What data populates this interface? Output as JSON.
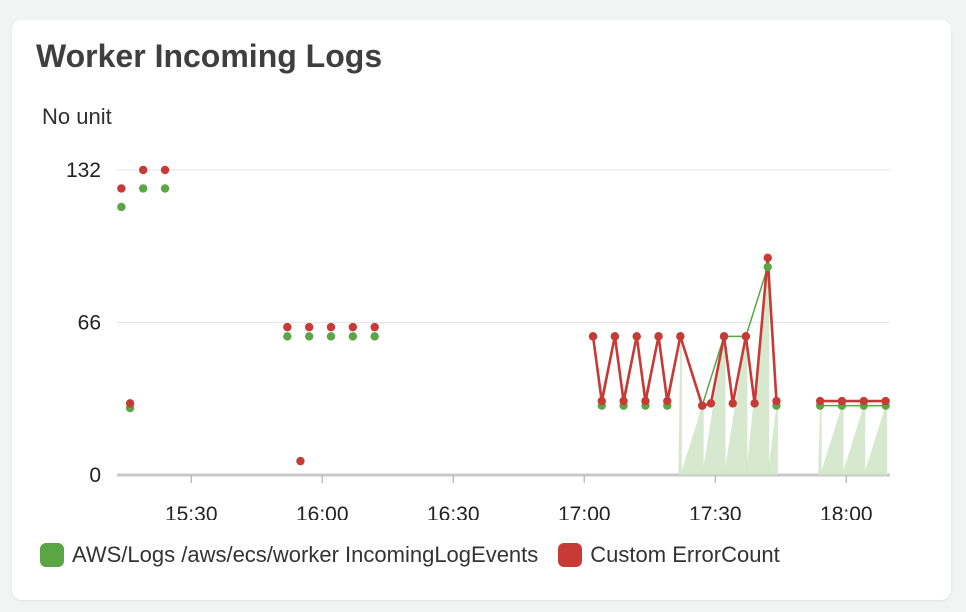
{
  "widget": {
    "title": "Worker Incoming Logs"
  },
  "chart_data": {
    "type": "line",
    "title": "Worker Incoming Logs",
    "ylabel": "No unit",
    "xlabel": "",
    "ylim": [
      0,
      132
    ],
    "yticks": [
      0,
      66,
      132
    ],
    "xlim": [
      "15:13",
      "18:10"
    ],
    "xticks": [
      "15:30",
      "16:00",
      "16:30",
      "17:00",
      "17:30",
      "18:00"
    ],
    "grid": true,
    "legend_position": "bottom-left",
    "series": [
      {
        "name": "AWS/Logs /aws/ecs/worker IncomingLogEvents",
        "color": "#5aa544",
        "points": [
          [
            "15:14",
            116
          ],
          [
            "15:16",
            29
          ],
          [
            "15:19",
            124
          ],
          [
            "15:24",
            124
          ],
          [
            "15:52",
            60
          ],
          [
            "15:57",
            60
          ],
          [
            "16:02",
            60
          ],
          [
            "16:07",
            60
          ],
          [
            "16:12",
            60
          ],
          [
            "17:02",
            60
          ],
          [
            "17:04",
            30
          ],
          [
            "17:07",
            60
          ],
          [
            "17:09",
            30
          ],
          [
            "17:12",
            60
          ],
          [
            "17:14",
            30
          ],
          [
            "17:17",
            60
          ],
          [
            "17:19",
            30
          ],
          [
            "17:22",
            60
          ],
          [
            "17:27",
            30
          ],
          [
            "17:32",
            60
          ],
          [
            "17:37",
            60
          ],
          [
            "17:42",
            90
          ],
          [
            "17:44",
            30
          ],
          [
            "17:54",
            30
          ],
          [
            "17:59",
            30
          ],
          [
            "18:04",
            30
          ],
          [
            "18:09",
            30
          ]
        ]
      },
      {
        "name": "Custom ErrorCount",
        "color": "#c83a35",
        "points": [
          [
            "15:14",
            124
          ],
          [
            "15:16",
            31
          ],
          [
            "15:19",
            132
          ],
          [
            "15:24",
            132
          ],
          [
            "15:52",
            64
          ],
          [
            "15:55",
            6
          ],
          [
            "15:57",
            64
          ],
          [
            "16:02",
            64
          ],
          [
            "16:07",
            64
          ],
          [
            "16:12",
            64
          ],
          [
            "17:02",
            60
          ],
          [
            "17:04",
            32
          ],
          [
            "17:07",
            60
          ],
          [
            "17:09",
            32
          ],
          [
            "17:12",
            60
          ],
          [
            "17:14",
            32
          ],
          [
            "17:17",
            60
          ],
          [
            "17:19",
            32
          ],
          [
            "17:22",
            60
          ],
          [
            "17:27",
            30
          ],
          [
            "17:29",
            31
          ],
          [
            "17:32",
            60
          ],
          [
            "17:34",
            31
          ],
          [
            "17:37",
            60
          ],
          [
            "17:39",
            31
          ],
          [
            "17:42",
            94
          ],
          [
            "17:44",
            32
          ],
          [
            "17:54",
            32
          ],
          [
            "17:59",
            32
          ],
          [
            "18:04",
            32
          ],
          [
            "18:09",
            32
          ]
        ]
      }
    ]
  }
}
